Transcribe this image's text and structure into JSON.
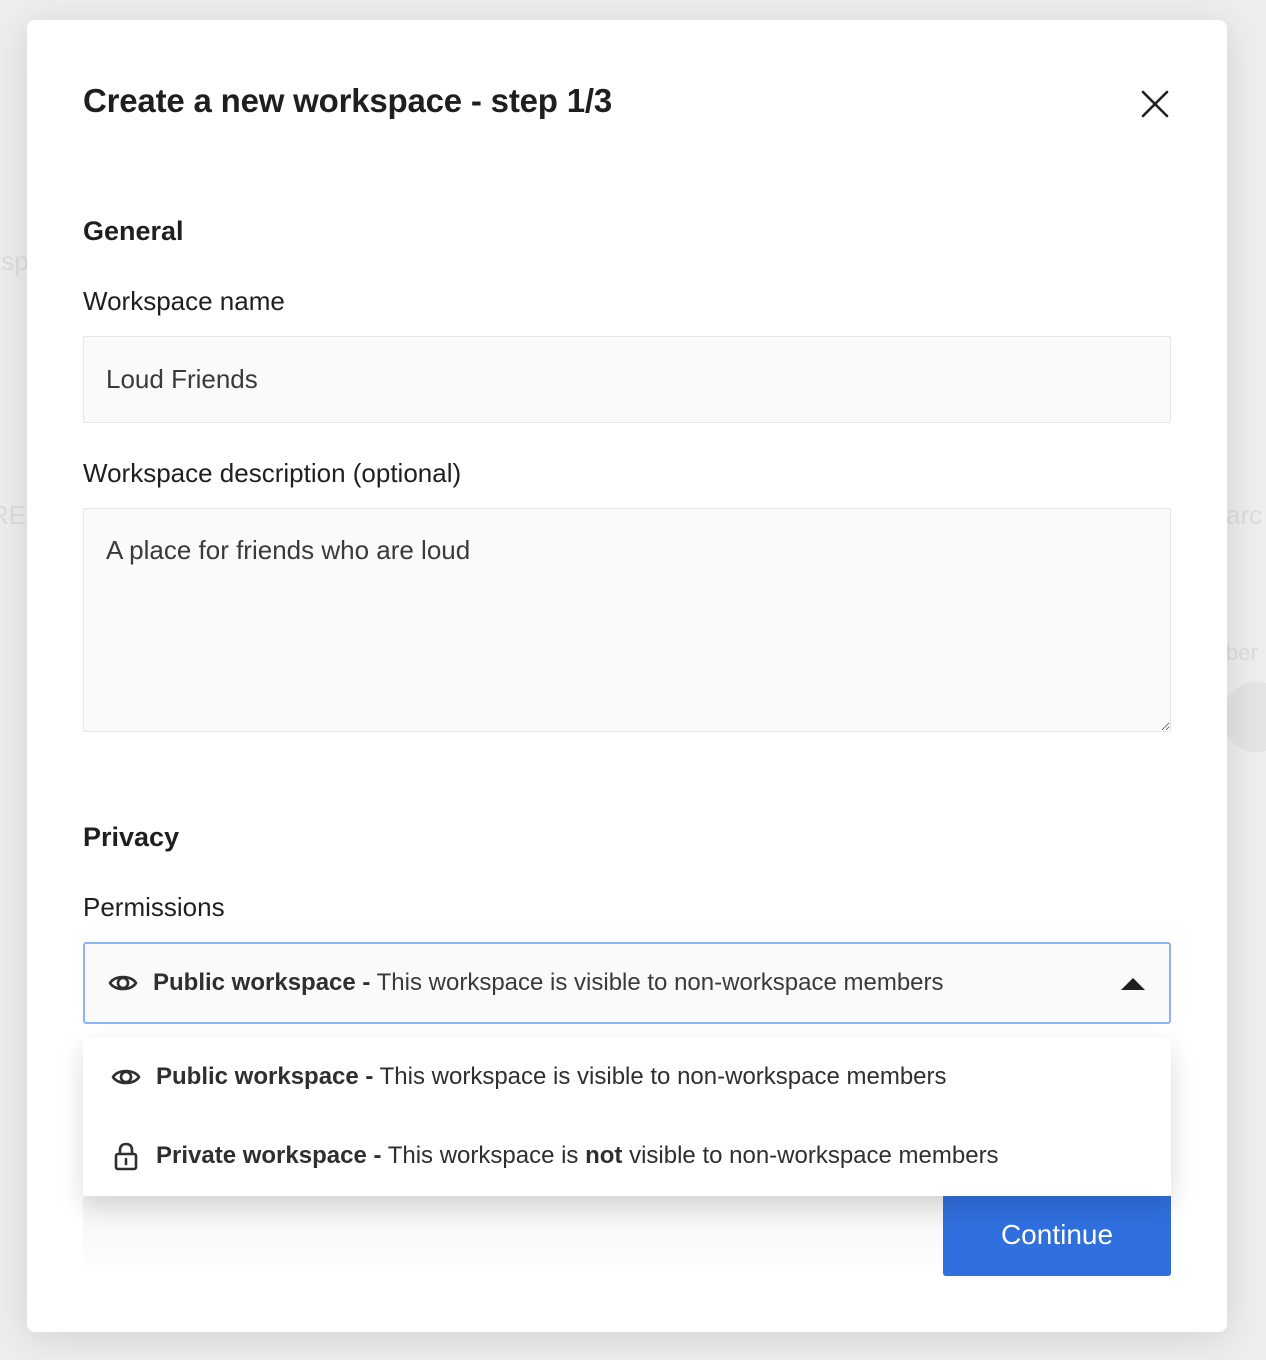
{
  "background": {
    "fragments": [
      "tsp",
      "RE",
      "arc",
      "ber"
    ]
  },
  "modal": {
    "title": "Create a new workspace - step 1/3",
    "close_icon": "close-icon"
  },
  "general": {
    "heading": "General",
    "name_label": "Workspace name",
    "name_value": "Loud Friends",
    "description_label": "Workspace description (optional)",
    "description_value": "A place for friends who are loud"
  },
  "privacy": {
    "heading": "Privacy",
    "permissions_label": "Permissions",
    "selected": {
      "icon": "eye-icon",
      "title": "Public workspace -",
      "description": "This workspace is visible to non-workspace members"
    },
    "options": [
      {
        "icon": "eye-icon",
        "title": "Public workspace -",
        "description": "This workspace is visible to non-workspace members"
      },
      {
        "icon": "lock-icon",
        "title": "Private workspace -",
        "description_before": "This workspace is",
        "description_emphasis": "not",
        "description_after": "visible to non-workspace members"
      }
    ]
  },
  "footer": {
    "continue_label": "Continue"
  },
  "colors": {
    "accent": "#2f6fde",
    "select_border": "#8db5f2",
    "text": "#1f1f1f"
  }
}
